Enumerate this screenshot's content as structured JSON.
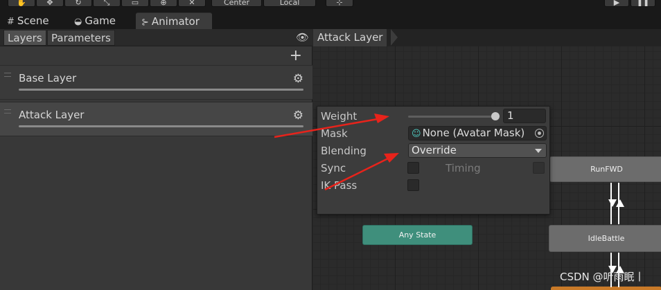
{
  "toolbar": {
    "pivot_label": "Center",
    "space_label": "Local"
  },
  "tabs": [
    {
      "label": "Scene",
      "icon": "grid-icon"
    },
    {
      "label": "Game",
      "icon": "gamepad-icon"
    },
    {
      "label": "Animator",
      "icon": "animator-icon",
      "active": true
    }
  ],
  "animator": {
    "layers_tab": "Layers",
    "parameters_tab": "Parameters",
    "layers": [
      {
        "name": "Base Layer"
      },
      {
        "name": "Attack Layer",
        "selected": true
      }
    ]
  },
  "graph": {
    "breadcrumb": "Attack Layer",
    "nodes": {
      "run": "RunFWD",
      "idle": "IdleBattle",
      "any": "Any State"
    }
  },
  "layer_settings": {
    "weight_label": "Weight",
    "weight_value": "1",
    "weight_fraction": 1.0,
    "mask_label": "Mask",
    "mask_value": "None (Avatar Mask)",
    "blending_label": "Blending",
    "blending_value": "Override",
    "sync_label": "Sync",
    "timing_label": "Timing",
    "ikpass_label": "IK Pass"
  },
  "watermark": "CSDN @听雨眠丨",
  "colors": {
    "any_state": "#3f8f7c",
    "state": "#6c6c6c",
    "annotation_arrow": "#e8231b"
  }
}
